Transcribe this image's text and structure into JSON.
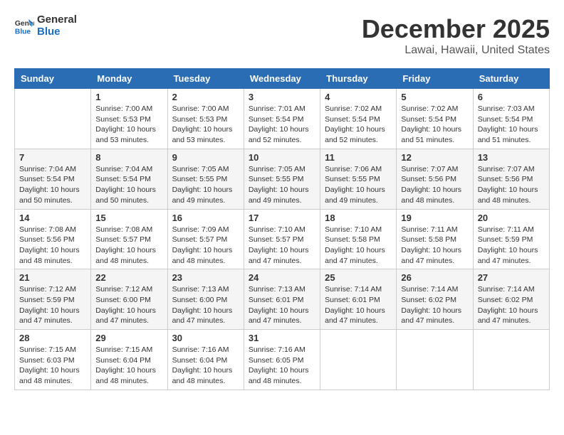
{
  "header": {
    "logo_general": "General",
    "logo_blue": "Blue",
    "month": "December 2025",
    "location": "Lawai, Hawaii, United States"
  },
  "weekdays": [
    "Sunday",
    "Monday",
    "Tuesday",
    "Wednesday",
    "Thursday",
    "Friday",
    "Saturday"
  ],
  "weeks": [
    [
      null,
      {
        "num": "1",
        "info": "Sunrise: 7:00 AM\nSunset: 5:53 PM\nDaylight: 10 hours\nand 53 minutes."
      },
      {
        "num": "2",
        "info": "Sunrise: 7:00 AM\nSunset: 5:53 PM\nDaylight: 10 hours\nand 53 minutes."
      },
      {
        "num": "3",
        "info": "Sunrise: 7:01 AM\nSunset: 5:54 PM\nDaylight: 10 hours\nand 52 minutes."
      },
      {
        "num": "4",
        "info": "Sunrise: 7:02 AM\nSunset: 5:54 PM\nDaylight: 10 hours\nand 52 minutes."
      },
      {
        "num": "5",
        "info": "Sunrise: 7:02 AM\nSunset: 5:54 PM\nDaylight: 10 hours\nand 51 minutes."
      },
      {
        "num": "6",
        "info": "Sunrise: 7:03 AM\nSunset: 5:54 PM\nDaylight: 10 hours\nand 51 minutes."
      }
    ],
    [
      {
        "num": "7",
        "info": "Sunrise: 7:04 AM\nSunset: 5:54 PM\nDaylight: 10 hours\nand 50 minutes."
      },
      {
        "num": "8",
        "info": "Sunrise: 7:04 AM\nSunset: 5:54 PM\nDaylight: 10 hours\nand 50 minutes."
      },
      {
        "num": "9",
        "info": "Sunrise: 7:05 AM\nSunset: 5:55 PM\nDaylight: 10 hours\nand 49 minutes."
      },
      {
        "num": "10",
        "info": "Sunrise: 7:05 AM\nSunset: 5:55 PM\nDaylight: 10 hours\nand 49 minutes."
      },
      {
        "num": "11",
        "info": "Sunrise: 7:06 AM\nSunset: 5:55 PM\nDaylight: 10 hours\nand 49 minutes."
      },
      {
        "num": "12",
        "info": "Sunrise: 7:07 AM\nSunset: 5:56 PM\nDaylight: 10 hours\nand 48 minutes."
      },
      {
        "num": "13",
        "info": "Sunrise: 7:07 AM\nSunset: 5:56 PM\nDaylight: 10 hours\nand 48 minutes."
      }
    ],
    [
      {
        "num": "14",
        "info": "Sunrise: 7:08 AM\nSunset: 5:56 PM\nDaylight: 10 hours\nand 48 minutes."
      },
      {
        "num": "15",
        "info": "Sunrise: 7:08 AM\nSunset: 5:57 PM\nDaylight: 10 hours\nand 48 minutes."
      },
      {
        "num": "16",
        "info": "Sunrise: 7:09 AM\nSunset: 5:57 PM\nDaylight: 10 hours\nand 48 minutes."
      },
      {
        "num": "17",
        "info": "Sunrise: 7:10 AM\nSunset: 5:57 PM\nDaylight: 10 hours\nand 47 minutes."
      },
      {
        "num": "18",
        "info": "Sunrise: 7:10 AM\nSunset: 5:58 PM\nDaylight: 10 hours\nand 47 minutes."
      },
      {
        "num": "19",
        "info": "Sunrise: 7:11 AM\nSunset: 5:58 PM\nDaylight: 10 hours\nand 47 minutes."
      },
      {
        "num": "20",
        "info": "Sunrise: 7:11 AM\nSunset: 5:59 PM\nDaylight: 10 hours\nand 47 minutes."
      }
    ],
    [
      {
        "num": "21",
        "info": "Sunrise: 7:12 AM\nSunset: 5:59 PM\nDaylight: 10 hours\nand 47 minutes."
      },
      {
        "num": "22",
        "info": "Sunrise: 7:12 AM\nSunset: 6:00 PM\nDaylight: 10 hours\nand 47 minutes."
      },
      {
        "num": "23",
        "info": "Sunrise: 7:13 AM\nSunset: 6:00 PM\nDaylight: 10 hours\nand 47 minutes."
      },
      {
        "num": "24",
        "info": "Sunrise: 7:13 AM\nSunset: 6:01 PM\nDaylight: 10 hours\nand 47 minutes."
      },
      {
        "num": "25",
        "info": "Sunrise: 7:14 AM\nSunset: 6:01 PM\nDaylight: 10 hours\nand 47 minutes."
      },
      {
        "num": "26",
        "info": "Sunrise: 7:14 AM\nSunset: 6:02 PM\nDaylight: 10 hours\nand 47 minutes."
      },
      {
        "num": "27",
        "info": "Sunrise: 7:14 AM\nSunset: 6:02 PM\nDaylight: 10 hours\nand 47 minutes."
      }
    ],
    [
      {
        "num": "28",
        "info": "Sunrise: 7:15 AM\nSunset: 6:03 PM\nDaylight: 10 hours\nand 48 minutes."
      },
      {
        "num": "29",
        "info": "Sunrise: 7:15 AM\nSunset: 6:04 PM\nDaylight: 10 hours\nand 48 minutes."
      },
      {
        "num": "30",
        "info": "Sunrise: 7:16 AM\nSunset: 6:04 PM\nDaylight: 10 hours\nand 48 minutes."
      },
      {
        "num": "31",
        "info": "Sunrise: 7:16 AM\nSunset: 6:05 PM\nDaylight: 10 hours\nand 48 minutes."
      },
      null,
      null,
      null
    ]
  ]
}
